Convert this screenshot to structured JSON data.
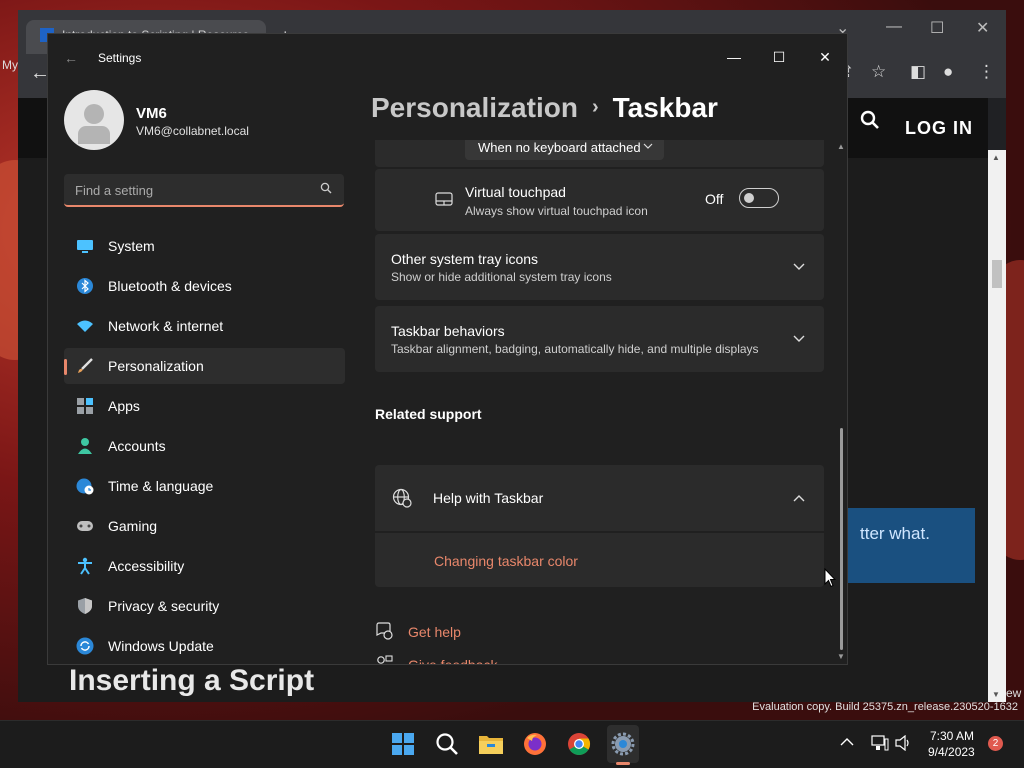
{
  "browser": {
    "tab_title": "Introduction to Scripting | Resource...",
    "login_label": "LOG IN",
    "banner_text": "tter what.",
    "page_title": "Inserting a Script",
    "partial_left_label": "My",
    "partial_right_label": "ew"
  },
  "settings": {
    "app_title": "Settings",
    "user": {
      "name": "VM6",
      "email": "VM6@collabnet.local"
    },
    "search": {
      "placeholder": "Find a setting"
    },
    "nav": [
      {
        "label": "System",
        "icon": "system-icon",
        "color": "#4cc2ff"
      },
      {
        "label": "Bluetooth & devices",
        "icon": "bluetooth-icon",
        "color": "#2b88d8"
      },
      {
        "label": "Network & internet",
        "icon": "wifi-icon",
        "color": "#4cc2ff"
      },
      {
        "label": "Personalization",
        "icon": "brush-icon",
        "color": "#e8a15a",
        "active": true
      },
      {
        "label": "Apps",
        "icon": "apps-icon",
        "color": "#9aa0a6"
      },
      {
        "label": "Accounts",
        "icon": "person-icon",
        "color": "#3ec7a2"
      },
      {
        "label": "Time & language",
        "icon": "globe-clock-icon",
        "color": "#2b88d8"
      },
      {
        "label": "Gaming",
        "icon": "gamepad-icon",
        "color": "#bfbfbf"
      },
      {
        "label": "Accessibility",
        "icon": "accessibility-icon",
        "color": "#4cc2ff"
      },
      {
        "label": "Privacy & security",
        "icon": "shield-icon",
        "color": "#9aa0a6"
      },
      {
        "label": "Windows Update",
        "icon": "update-icon",
        "color": "#2b88d8"
      }
    ],
    "breadcrumb": {
      "parent": "Personalization",
      "current": "Taskbar"
    },
    "touch_keyboard_dropdown": "When no keyboard attached",
    "virtual_touchpad": {
      "title": "Virtual touchpad",
      "desc": "Always show virtual touchpad icon",
      "state": "Off",
      "on": false
    },
    "other_tray": {
      "title": "Other system tray icons",
      "desc": "Show or hide additional system tray icons"
    },
    "taskbar_behaviors": {
      "title": "Taskbar behaviors",
      "desc": "Taskbar alignment, badging, automatically hide, and multiple displays"
    },
    "related_support": "Related support",
    "help_with": {
      "title": "Help with Taskbar",
      "link": "Changing taskbar color"
    },
    "get_help": "Get help",
    "give_feedback": "Give feedback",
    "accent_color": "#e8876b"
  },
  "watermark": "Evaluation copy. Build 25375.zn_release.230520-1632",
  "taskbar": {
    "apps": [
      "start-icon",
      "search-icon",
      "file-explorer-icon",
      "firefox-icon",
      "chrome-icon",
      "settings-icon"
    ],
    "time": "7:30 AM",
    "date": "9/4/2023",
    "notifications": "2"
  }
}
